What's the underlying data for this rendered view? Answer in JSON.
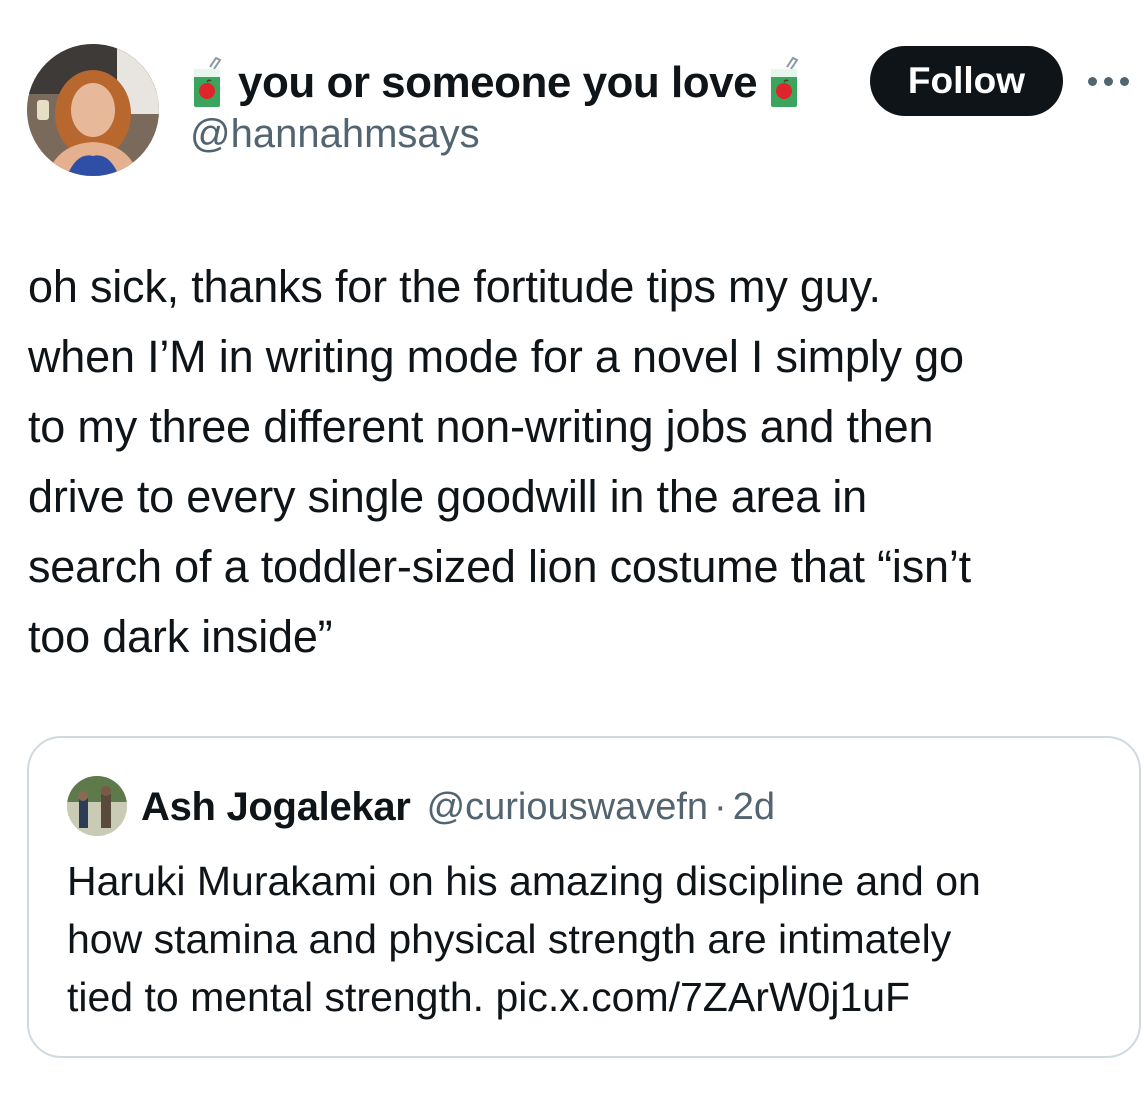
{
  "author": {
    "display_name": "you or someone you love",
    "handle": "@hannahmsays",
    "name_emoji": "juice-box-icon"
  },
  "actions": {
    "follow_label": "Follow",
    "more_icon": "more-horizontal-icon"
  },
  "tweet": {
    "text": "oh sick, thanks for the fortitude tips my guy.\nwhen I’M in writing mode for a novel I simply go\nto my three different non-writing jobs and then\ndrive to every single goodwill in the area in\nsearch of a toddler-sized lion costume that “isn’t\ntoo dark inside”"
  },
  "quote": {
    "name": "Ash Jogalekar",
    "handle": "@curiouswavefn",
    "separator": "·",
    "time": "2d",
    "text": "Haruki Murakami on his amazing discipline and on\nhow stamina and physical strength are intimately\ntied to mental strength. pic.x.com/7ZArW0j1uF"
  },
  "colors": {
    "text_primary": "#0f1419",
    "text_secondary": "#536471",
    "follow_bg": "#0f1419",
    "border": "#cfd9de"
  }
}
